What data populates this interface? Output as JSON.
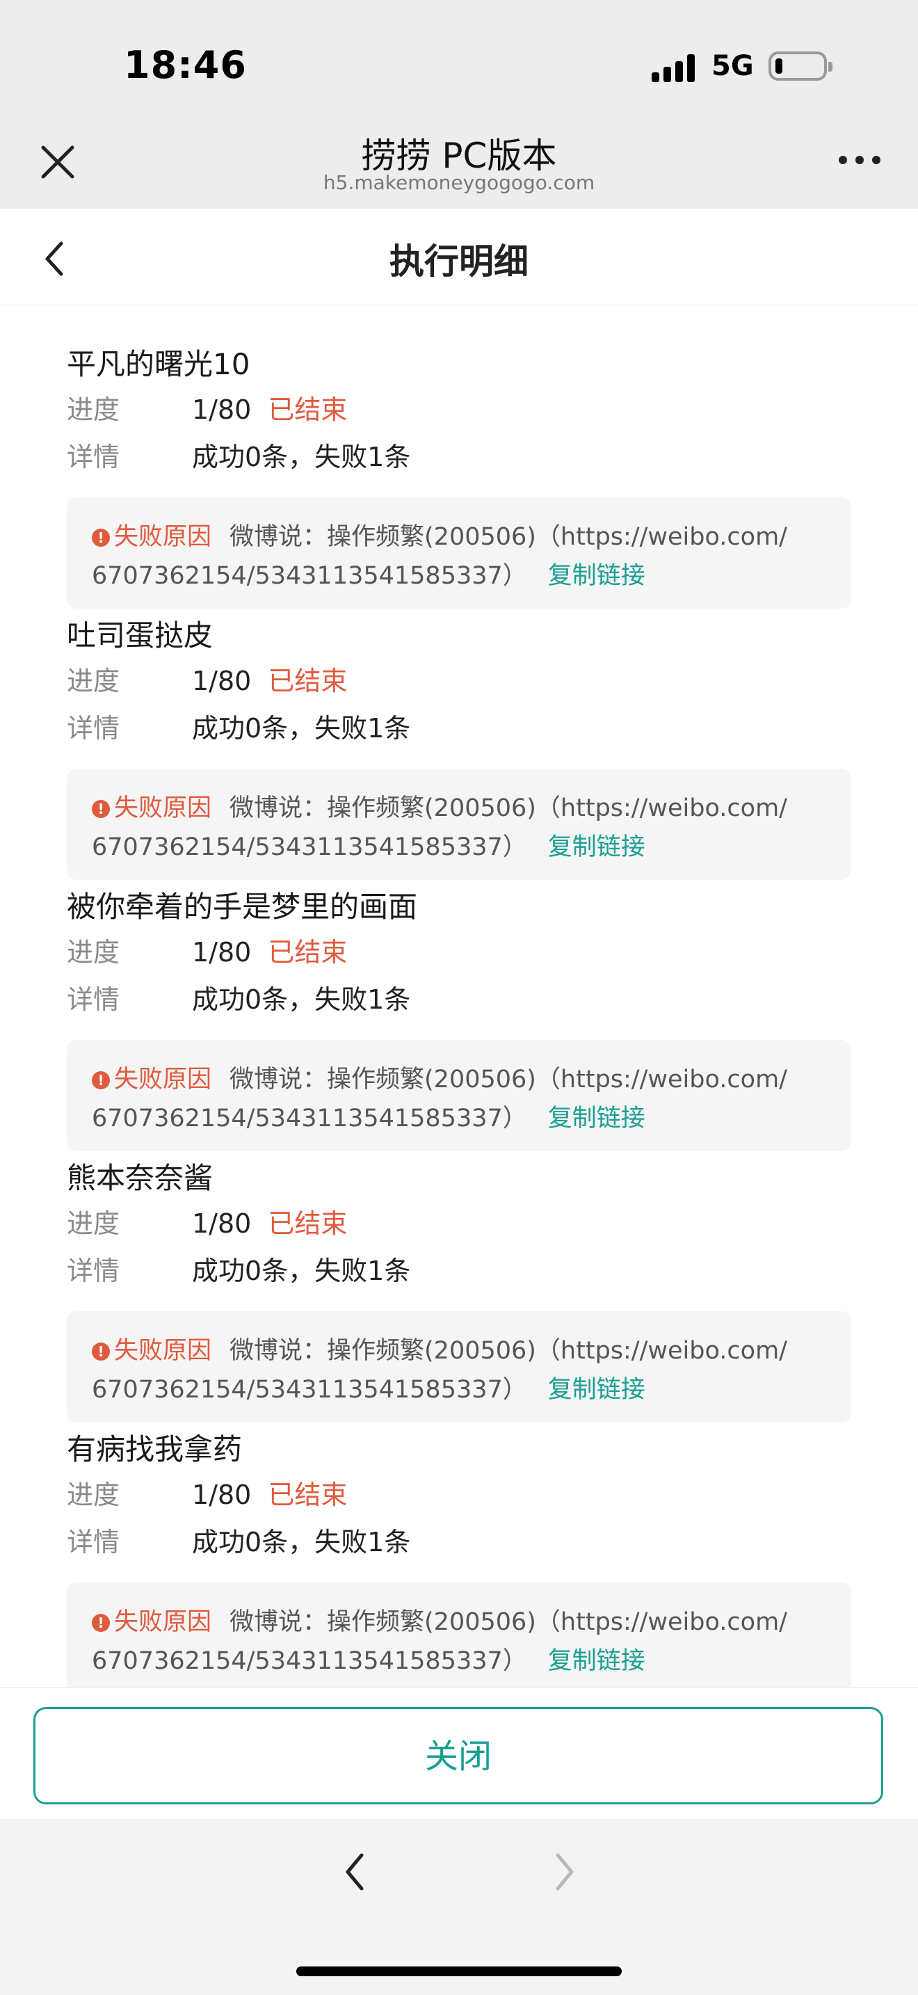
{
  "status_bar": {
    "time": "18:46",
    "network": "5G",
    "battery_level": 0.15
  },
  "browser": {
    "title": "捞捞 PC版本",
    "url": "h5.makemoneygogogo.com",
    "icons": {
      "close": "close-icon",
      "more": "more-dots-icon"
    }
  },
  "header": {
    "title": "执行明细",
    "back_icon": "chevron-left-icon"
  },
  "labels": {
    "progress": "进度",
    "detail": "详情",
    "fail_reason": "失败原因",
    "copy_link": "复制链接"
  },
  "colors": {
    "accent": "#1a9e93",
    "danger": "#e05a3d"
  },
  "items": [
    {
      "name": "平凡的曙光10",
      "progress": "1/80",
      "status": "已结束",
      "detail": "成功0条，失败1条",
      "reason_line1": "微博说：操作频繁(200506)（https://weibo.com/",
      "reason_line2": "6707362154/5343113541585337）"
    },
    {
      "name": "吐司蛋挞皮",
      "progress": "1/80",
      "status": "已结束",
      "detail": "成功0条，失败1条",
      "reason_line1": "微博说：操作频繁(200506)（https://weibo.com/",
      "reason_line2": "6707362154/5343113541585337）"
    },
    {
      "name": "被你牵着的手是梦里的画面",
      "progress": "1/80",
      "status": "已结束",
      "detail": "成功0条，失败1条",
      "reason_line1": "微博说：操作频繁(200506)（https://weibo.com/",
      "reason_line2": "6707362154/5343113541585337）"
    },
    {
      "name": "熊本奈奈酱",
      "progress": "1/80",
      "status": "已结束",
      "detail": "成功0条，失败1条",
      "reason_line1": "微博说：操作频繁(200506)（https://weibo.com/",
      "reason_line2": "6707362154/5343113541585337）"
    },
    {
      "name": "有病找我拿药",
      "progress": "1/80",
      "status": "已结束",
      "detail": "成功0条，失败1条",
      "reason_line1": "微博说：操作频繁(200506)（https://weibo.com/",
      "reason_line2": "6707362154/5343113541585337）"
    }
  ],
  "footer": {
    "close_label": "关闭"
  },
  "nav": {
    "back_icon": "chevron-left-icon",
    "forward_icon": "chevron-right-icon"
  }
}
